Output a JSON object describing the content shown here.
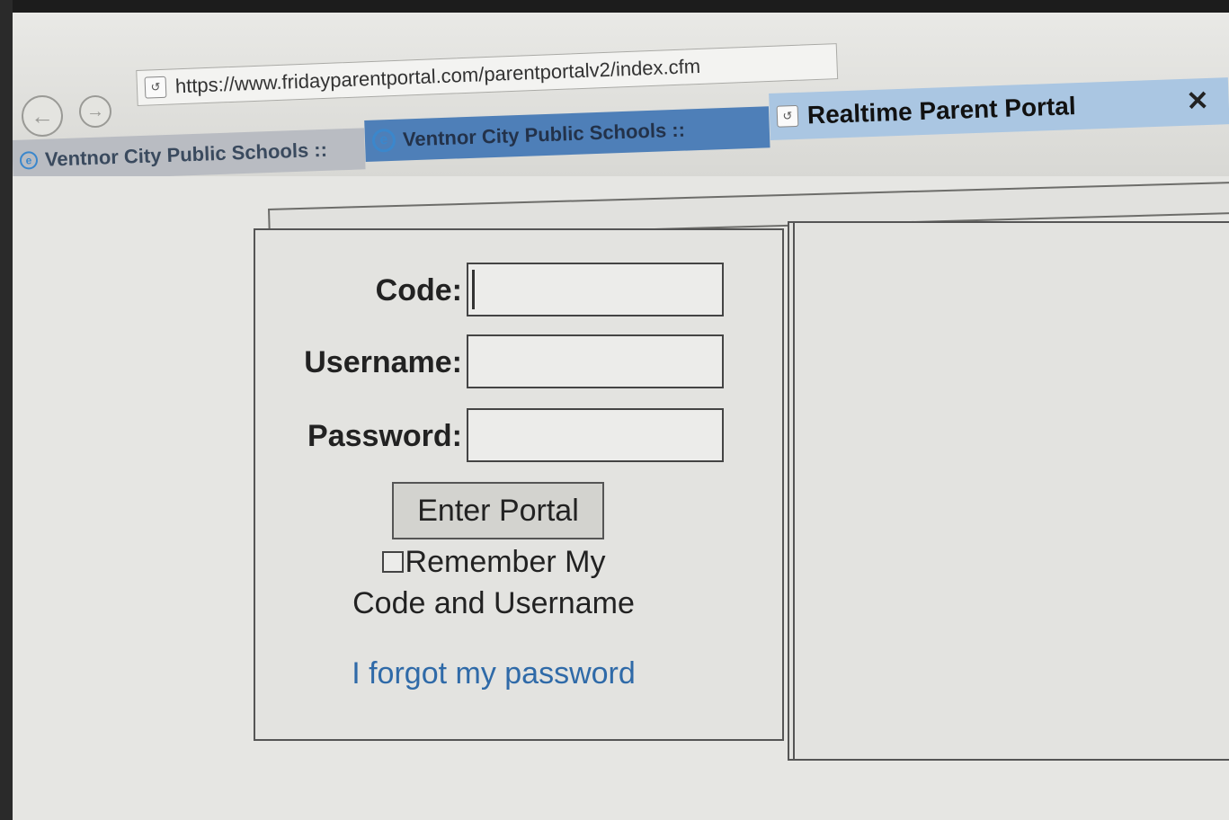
{
  "browser": {
    "url": "https://www.fridayparentportal.com/parentportalv2/index.cfm",
    "tabs": [
      {
        "label": "Ventnor City Public Schools ::"
      },
      {
        "label": "Ventnor City Public Schools ::"
      },
      {
        "label": "Realtime Parent Portal"
      }
    ],
    "close_glyph": "✕"
  },
  "login": {
    "code_label": "Code:",
    "username_label": "Username:",
    "password_label": "Password:",
    "code_value": "",
    "username_value": "",
    "password_value": "",
    "enter_button": "Enter Portal",
    "remember_line1": "Remember My",
    "remember_line2": "Code and Username",
    "forgot_link": "I forgot my password"
  },
  "colors": {
    "link": "#2f6aa8",
    "active_tab": "#aac6e2",
    "tab_blue": "#4e7fb8"
  },
  "icons": {
    "back": "back-arrow-icon",
    "forward": "forward-arrow-icon",
    "page": "page-icon",
    "ie": "internet-explorer-icon",
    "close": "close-icon"
  }
}
